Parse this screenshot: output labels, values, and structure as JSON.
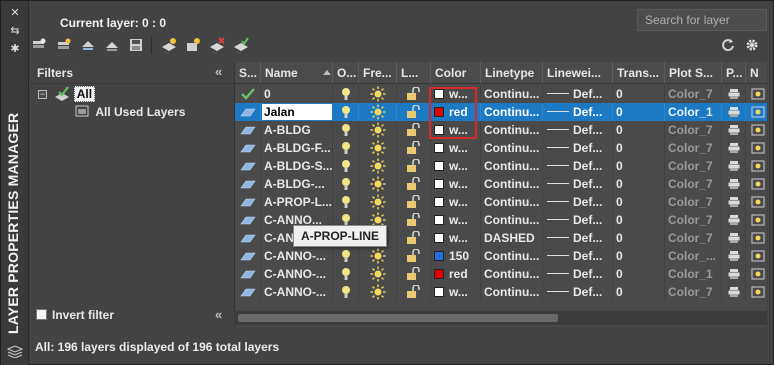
{
  "panel_title": "LAYER PROPERTIES MANAGER",
  "current_layer": "Current layer: 0 : 0",
  "search": {
    "placeholder": "Search for layer"
  },
  "filters": {
    "title": "Filters",
    "tree": [
      {
        "label": "All",
        "expanded": true
      },
      {
        "label": "All Used Layers"
      }
    ],
    "invert_label": "Invert filter",
    "invert_checked": false
  },
  "columns": [
    "S...",
    "Name",
    "O...",
    "Fre...",
    "L...",
    "Color",
    "Linetype",
    "Linewei...",
    "Trans...",
    "Plot S...",
    "P...",
    "N"
  ],
  "rows": [
    {
      "status": "check",
      "name": "0",
      "color_hex": "#ffffff",
      "color": "w...",
      "linetype": "Continu...",
      "lineweight": "Def...",
      "trans": "0",
      "plot_style": "Color_7"
    },
    {
      "status": "para",
      "name": "Jalan",
      "color_hex": "#e00000",
      "color": "red",
      "linetype": "Continu...",
      "lineweight": "Def...",
      "trans": "0",
      "plot_style": "Color_1",
      "selected": true,
      "editing": true
    },
    {
      "status": "para",
      "name": "A-BLDG",
      "color_hex": "#ffffff",
      "color": "w...",
      "linetype": "Continu...",
      "lineweight": "Def...",
      "trans": "0",
      "plot_style": "Color_7"
    },
    {
      "status": "para",
      "name": "A-BLDG-F...",
      "color_hex": "#ffffff",
      "color": "w...",
      "linetype": "Continu...",
      "lineweight": "Def...",
      "trans": "0",
      "plot_style": "Color_7"
    },
    {
      "status": "para",
      "name": "A-BLDG-S...",
      "color_hex": "#ffffff",
      "color": "w...",
      "linetype": "Continu...",
      "lineweight": "Def...",
      "trans": "0",
      "plot_style": "Color_7"
    },
    {
      "status": "para",
      "name": "A-BLDG-...",
      "color_hex": "#ffffff",
      "color": "w...",
      "linetype": "Continu...",
      "lineweight": "Def...",
      "trans": "0",
      "plot_style": "Color_7"
    },
    {
      "status": "para",
      "name": "A-PROP-L...",
      "color_hex": "#ffffff",
      "color": "w...",
      "linetype": "Continu...",
      "lineweight": "Def...",
      "trans": "0",
      "plot_style": "Color_7"
    },
    {
      "status": "para",
      "name": "C-ANNO...",
      "color_hex": "#ffffff",
      "color": "w...",
      "linetype": "Continu...",
      "lineweight": "Def...",
      "trans": "0",
      "plot_style": "Color_7"
    },
    {
      "status": "para",
      "name": "C-AN...",
      "color_hex": "#ffffff",
      "color": "w...",
      "linetype": "DASHED",
      "lineweight": "Def...",
      "trans": "0",
      "plot_style": "Color_7"
    },
    {
      "status": "para",
      "name": "C-ANNO-...",
      "color_hex": "#1e6fe0",
      "color": "150",
      "linetype": "Continu...",
      "lineweight": "Def...",
      "trans": "0",
      "plot_style": "Color_..."
    },
    {
      "status": "para",
      "name": "C-ANNO-...",
      "color_hex": "#e00000",
      "color": "red",
      "linetype": "Continu...",
      "lineweight": "Def...",
      "trans": "0",
      "plot_style": "Color_1"
    },
    {
      "status": "para",
      "name": "C-ANNO-...",
      "color_hex": "#ffffff",
      "color": "w...",
      "linetype": "Continu...",
      "lineweight": "Def...",
      "trans": "0",
      "plot_style": "Color_7"
    }
  ],
  "tooltip": "A-PROP-LINE",
  "status_bar": "All: 196 layers displayed of 196 total layers",
  "accent_colors": {
    "selection": "#1c79c4",
    "highlight": "#d42a2a"
  }
}
